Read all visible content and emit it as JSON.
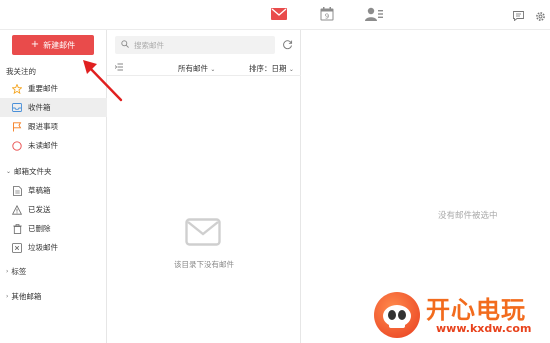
{
  "topbar": {
    "icons": [
      "mail-icon",
      "calendar-icon",
      "contacts-icon",
      "chat-icon",
      "settings-icon"
    ],
    "calendar_day": "9",
    "mail_color": "#e94b4b"
  },
  "sidebar": {
    "new_mail_label": "新建邮件",
    "followed_header": "我关注的",
    "followed_items": [
      {
        "label": "重要邮件",
        "icon": "star-icon"
      },
      {
        "label": "收件箱",
        "icon": "inbox-icon"
      },
      {
        "label": "跟进事项",
        "icon": "flag-icon"
      },
      {
        "label": "未读邮件",
        "icon": "unread-circle-icon"
      }
    ],
    "folders_header": "邮箱文件夹",
    "folder_items": [
      {
        "label": "草稿箱",
        "icon": "draft-icon"
      },
      {
        "label": "已发送",
        "icon": "sent-icon"
      },
      {
        "label": "已删除",
        "icon": "trash-icon"
      },
      {
        "label": "垃圾邮件",
        "icon": "spam-icon"
      }
    ],
    "tags_header": "标签",
    "other_header": "其他邮箱"
  },
  "list": {
    "search_placeholder": "搜索邮件",
    "all_mail": "所有邮件",
    "sort_label": "排序：日期",
    "empty_text": "该目录下没有邮件"
  },
  "reading": {
    "no_selection": "没有邮件被选中"
  },
  "watermark": {
    "title": "开心电玩",
    "url": "www.kxdw.com"
  },
  "colors": {
    "accent": "#e94b4b",
    "active_bg": "#eeeeee",
    "star": "#f5a623",
    "inbox": "#4a90d9",
    "flag": "#f57c1f",
    "unread": "#e94b4b"
  }
}
